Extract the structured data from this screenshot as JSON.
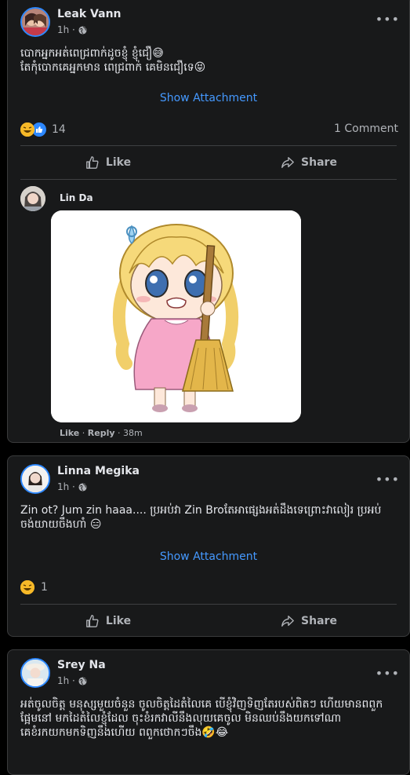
{
  "posts": [
    {
      "name": "Leak Vann",
      "time": "1h ·",
      "text": "បោកអ្នកអត់ពេជ្រពាក់ដូចខ្ញុំ ខ្ញុំជឿ😅\nតែកុំបោកគេអ្នកមាន ពេជ្រពាក់ គេមិនជឿទេ😝",
      "attachment_label": "Show Attachment",
      "reaction_count": "14",
      "comment_count": "1 Comment",
      "like_label": "Like",
      "share_label": "Share",
      "comment": {
        "name": "Lin Da",
        "like_label": "Like",
        "reply_label": "Reply",
        "time": "· 38m",
        "sep": "·"
      }
    },
    {
      "name": "Linna Megika",
      "time": "1h ·",
      "text": "Zin ot? Jum zin haaa.... ប្រអប់វា Zin Broតែអាផ្សេងអត់ដឹងទេព្រោះវាលៀរ ប្រអប់ ចង់យាយចឹងហាំ 😑",
      "attachment_label": "Show Attachment",
      "reaction_count": "1",
      "like_label": "Like",
      "share_label": "Share"
    },
    {
      "name": "Srey Na",
      "time": "1h ·",
      "text": "អត់ចូលចិត្ត មនុស្សមួយចំនួន ចូលចិត្តដៃតំលៃគេ បើខ្ញុំវិញទិញតែរបស់ពិតៗ ហើយមានពពួកផ្អែមនៅ មកដៃតំលៃខ្ញុំដែល ចុះខំរកវាលីនឹងលុយគេចូល មិនឈប់នឹងយកទៅណាគេខំរកយកមកទិញនឹងហើយ ពពួកថោកៗចឹង🤣😂"
    }
  ],
  "icons": {
    "globe": "globe-icon",
    "more": "more-icon",
    "like": "thumbs-up-icon",
    "share": "share-icon"
  },
  "colors": {
    "background": "#000000",
    "card": "#18191a",
    "link": "#4599ff",
    "text": "#e4e6eb",
    "muted": "#b0b3b8"
  }
}
